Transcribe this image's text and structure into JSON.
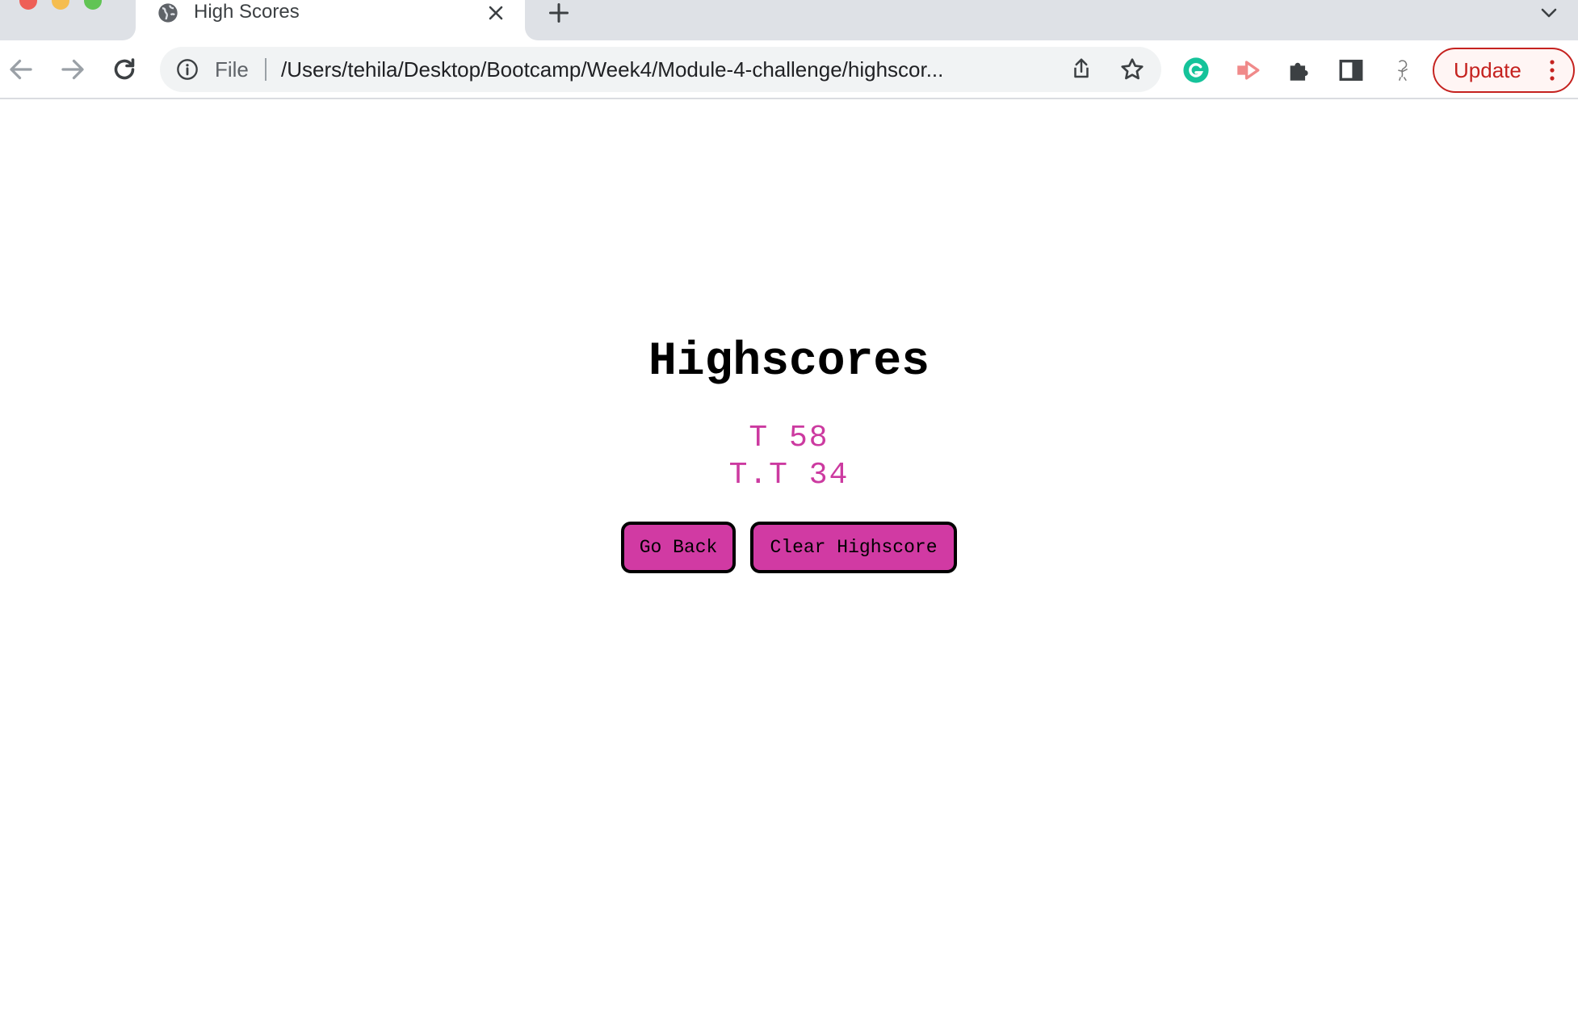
{
  "browser": {
    "tab": {
      "title": "High Scores"
    },
    "address_bar": {
      "scheme_label": "File",
      "url": "/Users/tehila/Desktop/Bootcamp/Week4/Module-4-challenge/highscor..."
    },
    "update_button": {
      "label": "Update"
    }
  },
  "page": {
    "heading": "Highscores",
    "scores": [
      {
        "text": "T 58"
      },
      {
        "text": "T.T 34"
      }
    ],
    "buttons": {
      "go_back": "Go Back",
      "clear": "Clear Highscore"
    }
  },
  "colors": {
    "accent_pink": "#d13aa3",
    "score_text": "#cc3aa0",
    "update_red": "#c5221f"
  },
  "icons": {
    "tab": "globe-icon",
    "close": "close-icon",
    "new_tab": "plus-icon",
    "info": "info-icon",
    "share": "share-icon",
    "bookmark": "star-icon",
    "extensions": [
      "grammarly-icon",
      "arrow-extension-icon",
      "puzzle-icon",
      "side-panel-icon",
      "profile-icon"
    ]
  }
}
